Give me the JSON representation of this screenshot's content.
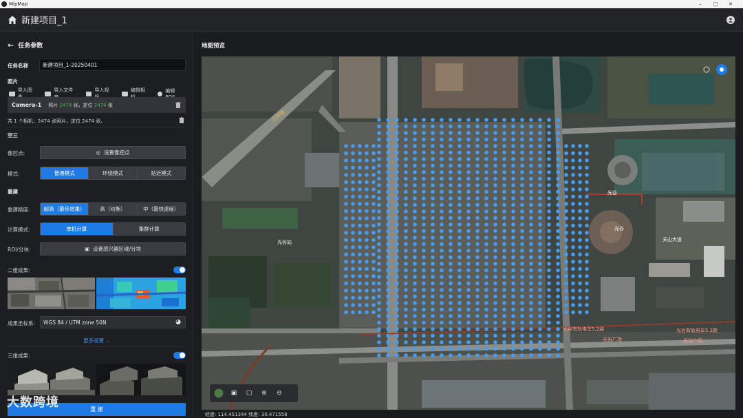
{
  "window": {
    "app_name": "MipMap"
  },
  "header": {
    "project_title": "新建项目_1"
  },
  "task": {
    "section_title": "任务参数",
    "name_label": "任务名称",
    "name_value": "新建项目_1-20250401",
    "photos_label": "照片",
    "tools": [
      "导入图像",
      "导入文件夹",
      "导入视频",
      "编辑相机",
      "编辑POS"
    ],
    "camera": {
      "name": "Camera-1",
      "photos_prefix": "照片",
      "photos_count": "2474",
      "photos_mid": "张，定位",
      "located_count": "2474",
      "photos_suffix": "张"
    },
    "summary": "共 1 个相机，2474 张照片，定位 2474 张。"
  },
  "aerial": {
    "section_title": "空三",
    "gcp_label": "像控点:",
    "gcp_button": "设置像控点",
    "mode_label": "模式:",
    "modes": [
      "普通模式",
      "环绕模式",
      "贴近模式"
    ]
  },
  "recon": {
    "section_title": "重建",
    "precision_label": "重建精度:",
    "precisions": [
      "超高（最佳效果）",
      "高（均衡）",
      "中（最快速度）"
    ],
    "compute_label": "计算模式:",
    "computes": [
      "单机计算",
      "集群计算"
    ],
    "roi_label": "ROI/分块:",
    "roi_button": "设置感兴趣区域/分块",
    "out2d_label": "二维成果:",
    "crs_label": "成果坐标系:",
    "crs_value": "WGS 84 / UTM zone 50N",
    "more_settings": "更多设置",
    "out3d_label": "三维成果:",
    "start_button": "重 建"
  },
  "map": {
    "title": "地图预览",
    "status_lon_label": "经度:",
    "status_lon": "114.451344",
    "status_lat_label": "纬度:",
    "status_lat": "30.471558",
    "labels": [
      "三环线",
      "光谷站",
      "光谷有轨电车5,2路",
      "光谷有轨电车5,2路",
      "光谷广场",
      "光谷广场",
      "光谷",
      "光谷",
      "关山大道"
    ],
    "marker_color": "#4a9cf0"
  },
  "watermark": "大数跨境",
  "colors": {
    "accent": "#1e7be6"
  }
}
